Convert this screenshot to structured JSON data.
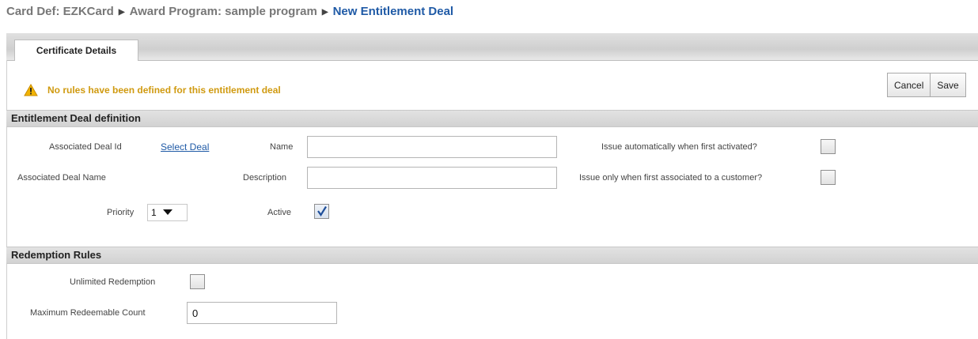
{
  "breadcrumb": {
    "card_def": "Card Def: EZKCard",
    "award_program": "Award Program: sample program",
    "current": "New Entitlement Deal"
  },
  "tabs": [
    {
      "label": "Certificate Details",
      "active": true
    }
  ],
  "warning": {
    "text": "No rules have been defined for this entitlement deal",
    "color": "#d09a10"
  },
  "actions": {
    "cancel_label": "Cancel",
    "save_label": "Save"
  },
  "definition": {
    "header": "Entitlement Deal definition",
    "associated_deal_id_label": "Associated Deal Id",
    "select_deal_link": "Select Deal",
    "associated_deal_name_label": "Associated Deal Name",
    "priority_label": "Priority",
    "priority_value": "1",
    "name_label": "Name",
    "name_value": "",
    "description_label": "Description",
    "description_value": "",
    "active_label": "Active",
    "active_checked": true,
    "issue_auto_label": "Issue automatically when first activated?",
    "issue_auto_checked": false,
    "issue_assoc_label": "Issue only when first associated to a customer?",
    "issue_assoc_checked": false
  },
  "redemption": {
    "header": "Redemption Rules",
    "unlimited_label": "Unlimited Redemption",
    "unlimited_checked": false,
    "max_count_label": "Maximum Redeemable Count",
    "max_count_value": "0"
  },
  "colors": {
    "link": "#1f5aa6",
    "breadcrumb_current": "#1f5aa6"
  }
}
